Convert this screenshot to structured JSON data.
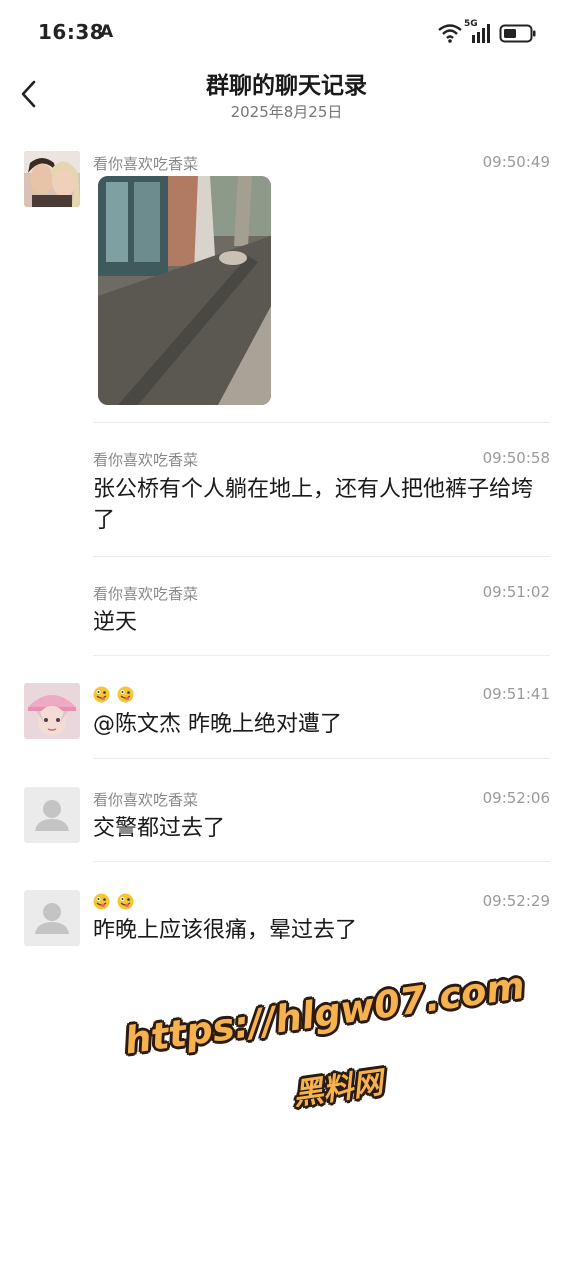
{
  "status_bar": {
    "time": "16:38",
    "indicator": "A",
    "network": "5G",
    "icons": [
      "wifi-icon",
      "signal-icon",
      "battery-icon"
    ]
  },
  "header": {
    "title": "群聊的聊天记录",
    "subtitle": "2025年8月25日"
  },
  "messages": [
    {
      "sender": "看你喜欢吃香菜",
      "time": "09:50:49",
      "type": "image"
    },
    {
      "sender": "看你喜欢吃香菜",
      "time": "09:50:58",
      "text": "张公桥有个人躺在地上，还有人把他裤子给垮了"
    },
    {
      "sender": "看你喜欢吃香菜",
      "time": "09:51:02",
      "text": "逆天"
    },
    {
      "sender": "",
      "sender_emoji": [
        "goofy-face-emoji",
        "goofy-face-emoji"
      ],
      "time": "09:51:41",
      "text": "@陈文杰 昨晚上绝对遭了"
    },
    {
      "sender": "看你喜欢吃香菜",
      "time": "09:52:06",
      "text": "交警都过去了"
    },
    {
      "sender": "",
      "sender_emoji": [
        "goofy-face-emoji",
        "goofy-face-emoji"
      ],
      "time": "09:52:29",
      "text": "昨晚上应该很痛，晕过去了"
    }
  ],
  "watermark": {
    "url": "https://hlgw07.com",
    "name": "黑料网"
  }
}
